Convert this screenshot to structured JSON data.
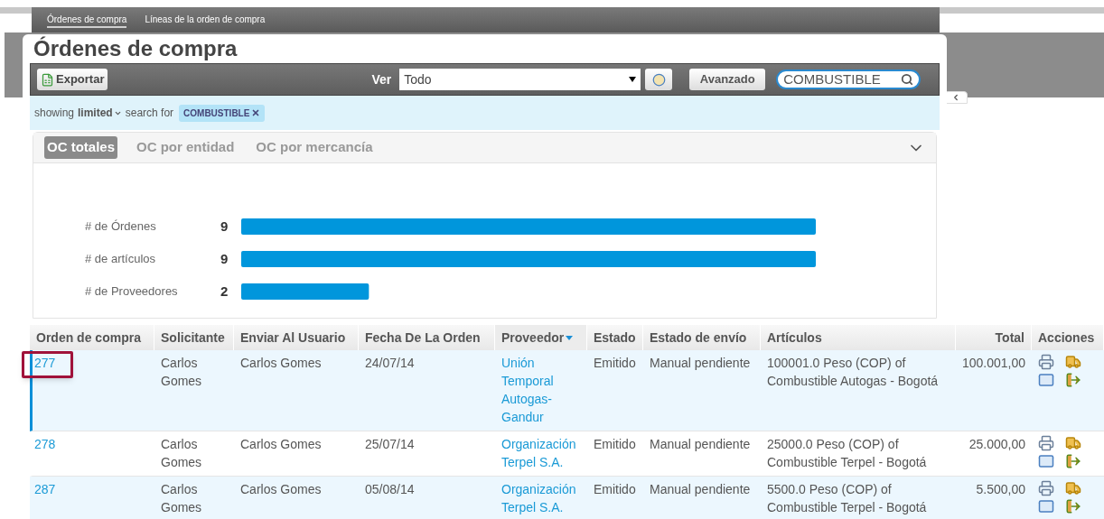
{
  "nav": {
    "tabs": [
      {
        "label": "Órdenes de compra",
        "selected": true
      },
      {
        "label": "Líneas de la orden de compra",
        "selected": false
      }
    ]
  },
  "title": "Órdenes de compra",
  "toolbar": {
    "export": "Exportar",
    "view_label": "Ver",
    "view_value": "Todo",
    "advanced": "Avanzado",
    "search_value": "COMBUSTIBLE"
  },
  "filter": {
    "showing": "showing",
    "mode": "limited",
    "search_for": "search for",
    "tag": "COMBUSTIBLE"
  },
  "chart_panel": {
    "tabs": [
      {
        "label": "OC totales",
        "selected": true
      },
      {
        "label": "OC por entidad",
        "selected": false
      },
      {
        "label": "OC por mercancía",
        "selected": false
      }
    ],
    "chart_data": {
      "type": "bar",
      "orientation": "horizontal",
      "categories": [
        "# de Órdenes",
        "# de artículos",
        "# de Proveedores"
      ],
      "values": [
        9,
        9,
        2
      ],
      "data_labels": true
    }
  },
  "table": {
    "columns": [
      {
        "label": "Orden de compra",
        "sorted": false
      },
      {
        "label": "Solicitante",
        "sorted": false
      },
      {
        "label": "Enviar Al Usuario",
        "sorted": false
      },
      {
        "label": "Fecha De La Orden",
        "sorted": false
      },
      {
        "label": "Proveedor",
        "sorted": true
      },
      {
        "label": "Estado",
        "sorted": false
      },
      {
        "label": "Estado de envío",
        "sorted": false
      },
      {
        "label": "Artículos",
        "sorted": false
      },
      {
        "label": "Total",
        "sorted": false
      },
      {
        "label": "Acciones",
        "sorted": false
      }
    ],
    "rows": [
      {
        "selected": true,
        "annotated": true,
        "order": "277",
        "requester": "Carlos Gomes",
        "send_to": "Carlos Gomes",
        "date": "24/07/14",
        "supplier": "Unión Temporal Autogas-Gandur",
        "status": "Emitido",
        "shipping": "Manual pendiente",
        "items": "100001.0 Peso (COP) of Combustible Autogas - Bogotá",
        "total": "100.001,00"
      },
      {
        "selected": false,
        "annotated": false,
        "order": "278",
        "requester": "Carlos Gomes",
        "send_to": "Carlos Gomes",
        "date": "25/07/14",
        "supplier": "Organización Terpel S.A.",
        "status": "Emitido",
        "shipping": "Manual pendiente",
        "items": "25000.0 Peso (COP) of Combustible Terpel - Bogotá",
        "total": "25.000,00"
      },
      {
        "selected": false,
        "annotated": false,
        "order": "287",
        "requester": "Carlos Gomes",
        "send_to": "Carlos Gomes",
        "date": "05/08/14",
        "supplier": "Organización Terpel S.A.",
        "status": "Emitido",
        "shipping": "Manual pendiente",
        "items": "5500.0 Peso (COP) of Combustible Terpel - Bogotá",
        "total": "5.500,00"
      }
    ]
  }
}
